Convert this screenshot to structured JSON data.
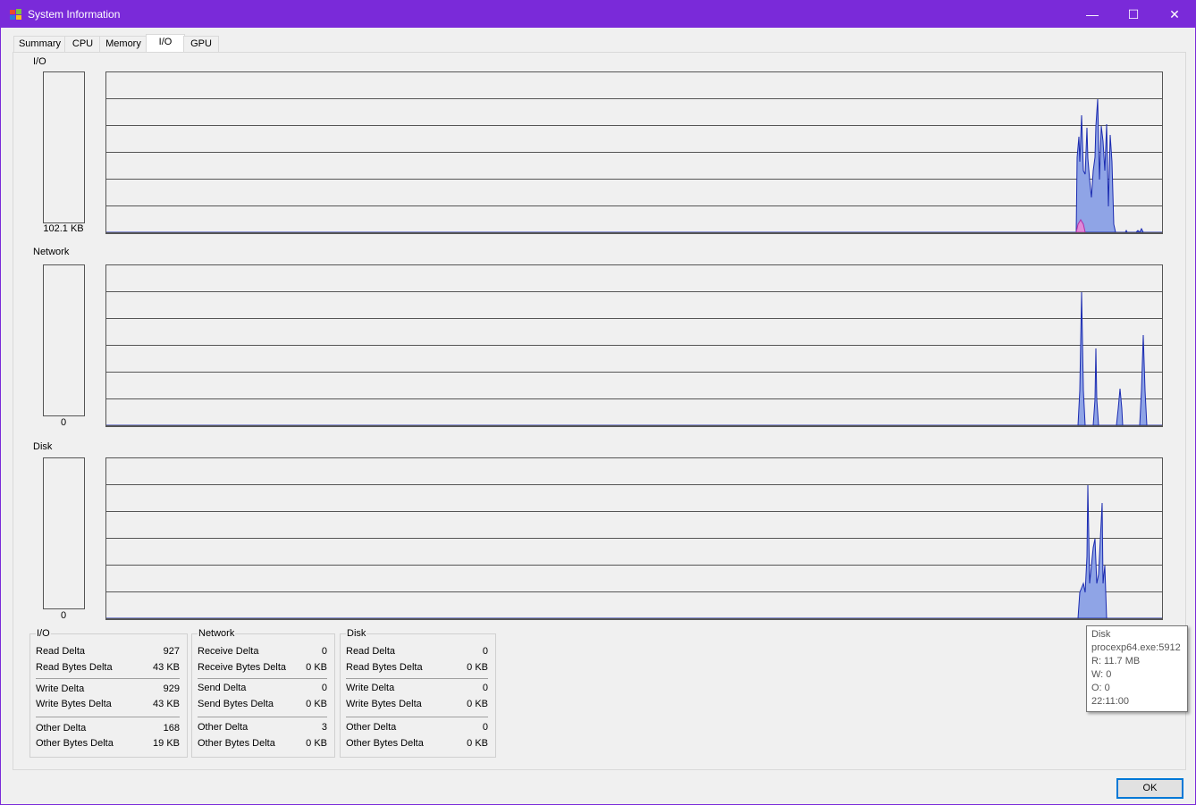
{
  "window": {
    "title": "System Information",
    "minimize": "—",
    "maximize": "☐",
    "close": "✕"
  },
  "tabs": [
    {
      "label": "Summary",
      "active": false
    },
    {
      "label": "CPU",
      "active": false
    },
    {
      "label": "Memory",
      "active": false
    },
    {
      "label": "I/O",
      "active": true
    },
    {
      "label": "GPU",
      "active": false
    }
  ],
  "sections": {
    "io": {
      "label": "I/O",
      "meter_value": "102.1  KB"
    },
    "network": {
      "label": "Network",
      "meter_value": "0"
    },
    "disk": {
      "label": "Disk",
      "meter_value": "0"
    }
  },
  "stats": {
    "io": {
      "title": "I/O",
      "read_delta_label": "Read Delta",
      "read_delta": "927",
      "read_bytes_label": "Read Bytes Delta",
      "read_bytes": "43 KB",
      "write_delta_label": "Write Delta",
      "write_delta": "929",
      "write_bytes_label": "Write Bytes Delta",
      "write_bytes": "43 KB",
      "other_delta_label": "Other Delta",
      "other_delta": "168",
      "other_bytes_label": "Other Bytes Delta",
      "other_bytes": "19 KB"
    },
    "network": {
      "title": "Network",
      "receive_delta_label": "Receive Delta",
      "receive_delta": "0",
      "receive_bytes_label": "Receive Bytes Delta",
      "receive_bytes": "0 KB",
      "send_delta_label": "Send Delta",
      "send_delta": "0",
      "send_bytes_label": "Send Bytes Delta",
      "send_bytes": "0 KB",
      "other_delta_label": "Other Delta",
      "other_delta": "3",
      "other_bytes_label": "Other Bytes Delta",
      "other_bytes": "0 KB"
    },
    "disk": {
      "title": "Disk",
      "read_delta_label": "Read Delta",
      "read_delta": "0",
      "read_bytes_label": "Read Bytes Delta",
      "read_bytes": "0 KB",
      "write_delta_label": "Write Delta",
      "write_delta": "0",
      "write_bytes_label": "Write Bytes Delta",
      "write_bytes": "0 KB",
      "other_delta_label": "Other Delta",
      "other_delta": "0",
      "other_bytes_label": "Other Bytes Delta",
      "other_bytes": "0 KB"
    }
  },
  "tooltip": {
    "title": "Disk",
    "process": "procexp64.exe:5912",
    "read": "R: 11.7  MB",
    "write": "W: 0",
    "other": "O: 0",
    "time": "22:11:00"
  },
  "ok_label": "OK",
  "colors": {
    "accent": "#7a2ad9",
    "graph_fill": "#8fa4e6",
    "graph_line": "#1a2ab0",
    "graph_write": "#e08ad8"
  },
  "icons": {
    "app": "system-information-icon"
  }
}
